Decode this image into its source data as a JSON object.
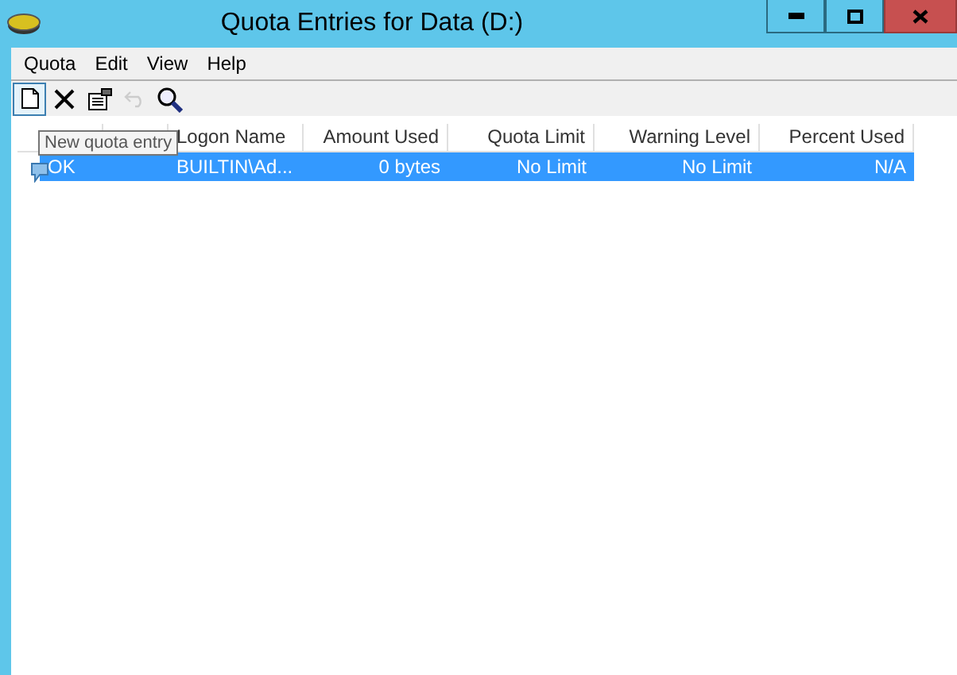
{
  "window": {
    "title": "Quota Entries for Data (D:)"
  },
  "menu": [
    "Quota",
    "Edit",
    "View",
    "Help"
  ],
  "toolbar": [
    {
      "kind": "new",
      "disabled": false,
      "selected": true
    },
    {
      "kind": "delete",
      "disabled": false,
      "selected": false
    },
    {
      "kind": "properties",
      "disabled": false,
      "selected": false
    },
    {
      "kind": "undo",
      "disabled": true,
      "selected": false
    },
    {
      "kind": "find",
      "disabled": false,
      "selected": false
    }
  ],
  "tooltip": "New quota entry",
  "table": {
    "columns": [
      "",
      "",
      "Logon Name",
      "Amount Used",
      "Quota Limit",
      "Warning Level",
      "Percent Used"
    ],
    "rows": [
      {
        "selected": true,
        "cells": [
          "OK",
          null,
          "BUILTIN\\Ad...",
          "0 bytes",
          "No Limit",
          "No Limit",
          "N/A"
        ]
      }
    ]
  }
}
